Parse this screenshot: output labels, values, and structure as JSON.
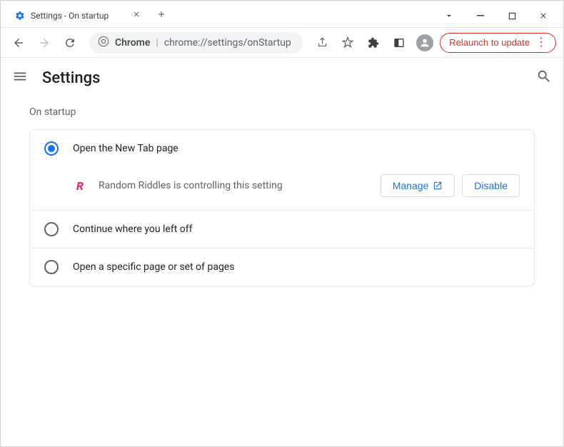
{
  "tab": {
    "title": "Settings - On startup"
  },
  "omnibox": {
    "prefix": "Chrome",
    "path": "chrome://settings/onStartup"
  },
  "relaunch": {
    "label": "Relaunch to update"
  },
  "header": {
    "title": "Settings"
  },
  "section": {
    "title": "On startup"
  },
  "options": {
    "opt1": {
      "label": "Open the New Tab page"
    },
    "opt2": {
      "label": "Continue where you left off"
    },
    "opt3": {
      "label": "Open a specific page or set of pages"
    }
  },
  "extension": {
    "name": "Random Riddles is controlling this setting",
    "icon_letter": "R",
    "manage": "Manage",
    "disable": "Disable"
  }
}
